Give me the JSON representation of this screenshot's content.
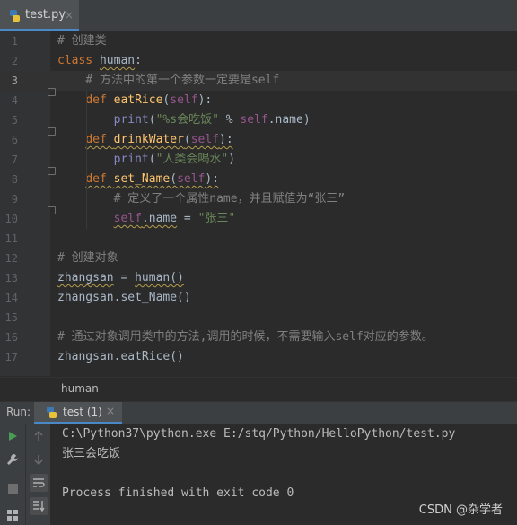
{
  "file_tab": {
    "label": "test.py",
    "close": "×"
  },
  "lines": [
    {
      "num": "1",
      "parts": [
        {
          "t": "# 创建类",
          "c": "cm"
        }
      ]
    },
    {
      "num": "2",
      "parts": [
        {
          "t": "class ",
          "c": "kw"
        },
        {
          "t": "human",
          "c": "wv"
        },
        {
          "t": ":",
          "c": ""
        }
      ]
    },
    {
      "num": "3",
      "parts": [
        {
          "t": "    # 方法中的第一个参数一定要是self",
          "c": "cm"
        }
      ]
    },
    {
      "num": "4",
      "parts": [
        {
          "t": "    ",
          "c": ""
        },
        {
          "t": "def ",
          "c": "kw"
        },
        {
          "t": "eatRice",
          "c": "fn"
        },
        {
          "t": "(",
          "c": ""
        },
        {
          "t": "self",
          "c": "self"
        },
        {
          "t": "):",
          "c": ""
        }
      ]
    },
    {
      "num": "5",
      "parts": [
        {
          "t": "        ",
          "c": ""
        },
        {
          "t": "print",
          "c": "bi"
        },
        {
          "t": "(",
          "c": ""
        },
        {
          "t": "\"%s会吃饭\"",
          "c": "str"
        },
        {
          "t": " % ",
          "c": ""
        },
        {
          "t": "self",
          "c": "self"
        },
        {
          "t": ".name)",
          "c": ""
        }
      ]
    },
    {
      "num": "6",
      "parts": [
        {
          "t": "    ",
          "c": ""
        },
        {
          "t": "def ",
          "c": "kwv"
        },
        {
          "t": "drinkWater",
          "c": "fnv"
        },
        {
          "t": "(",
          "c": "wv"
        },
        {
          "t": "self",
          "c": "selfv"
        },
        {
          "t": "):",
          "c": "wv"
        }
      ]
    },
    {
      "num": "7",
      "parts": [
        {
          "t": "        ",
          "c": ""
        },
        {
          "t": "print",
          "c": "bi"
        },
        {
          "t": "(",
          "c": ""
        },
        {
          "t": "\"人类会喝水\"",
          "c": "str"
        },
        {
          "t": ")",
          "c": ""
        }
      ]
    },
    {
      "num": "8",
      "parts": [
        {
          "t": "    ",
          "c": ""
        },
        {
          "t": "def ",
          "c": "kwv"
        },
        {
          "t": "set_Name",
          "c": "fnv"
        },
        {
          "t": "(",
          "c": "wv"
        },
        {
          "t": "self",
          "c": "selfv"
        },
        {
          "t": "):",
          "c": "wv"
        }
      ]
    },
    {
      "num": "9",
      "parts": [
        {
          "t": "        # 定义了一个属性name，并且赋值为“张三”",
          "c": "cm"
        }
      ]
    },
    {
      "num": "10",
      "parts": [
        {
          "t": "        ",
          "c": ""
        },
        {
          "t": "self",
          "c": "selfv"
        },
        {
          "t": ".name",
          "c": "wv"
        },
        {
          "t": " = ",
          "c": ""
        },
        {
          "t": "\"张三\"",
          "c": "str"
        }
      ]
    },
    {
      "num": "11",
      "parts": []
    },
    {
      "num": "12",
      "parts": [
        {
          "t": "# 创建对象",
          "c": "cm"
        }
      ]
    },
    {
      "num": "13",
      "parts": [
        {
          "t": "zhangsan",
          "c": "wv"
        },
        {
          "t": " = ",
          "c": ""
        },
        {
          "t": "human()",
          "c": "wv"
        }
      ]
    },
    {
      "num": "14",
      "parts": [
        {
          "t": "zhangsan.set_Name()",
          "c": ""
        }
      ]
    },
    {
      "num": "15",
      "parts": []
    },
    {
      "num": "16",
      "parts": [
        {
          "t": "# 通过对象调用类中的方法,调用的时候，不需要输入self对应的参数。",
          "c": "cm"
        }
      ]
    },
    {
      "num": "17",
      "parts": [
        {
          "t": "zhangsan.eatRice()",
          "c": ""
        }
      ]
    }
  ],
  "breadcrumb": "human",
  "run": {
    "label": "Run:",
    "tab": "test (1)",
    "close": "×"
  },
  "console": [
    "C:\\Python37\\python.exe E:/stq/Python/HelloPython/test.py",
    "张三会吃饭",
    "",
    "Process finished with exit code 0"
  ],
  "watermark": "CSDN @杂学者"
}
